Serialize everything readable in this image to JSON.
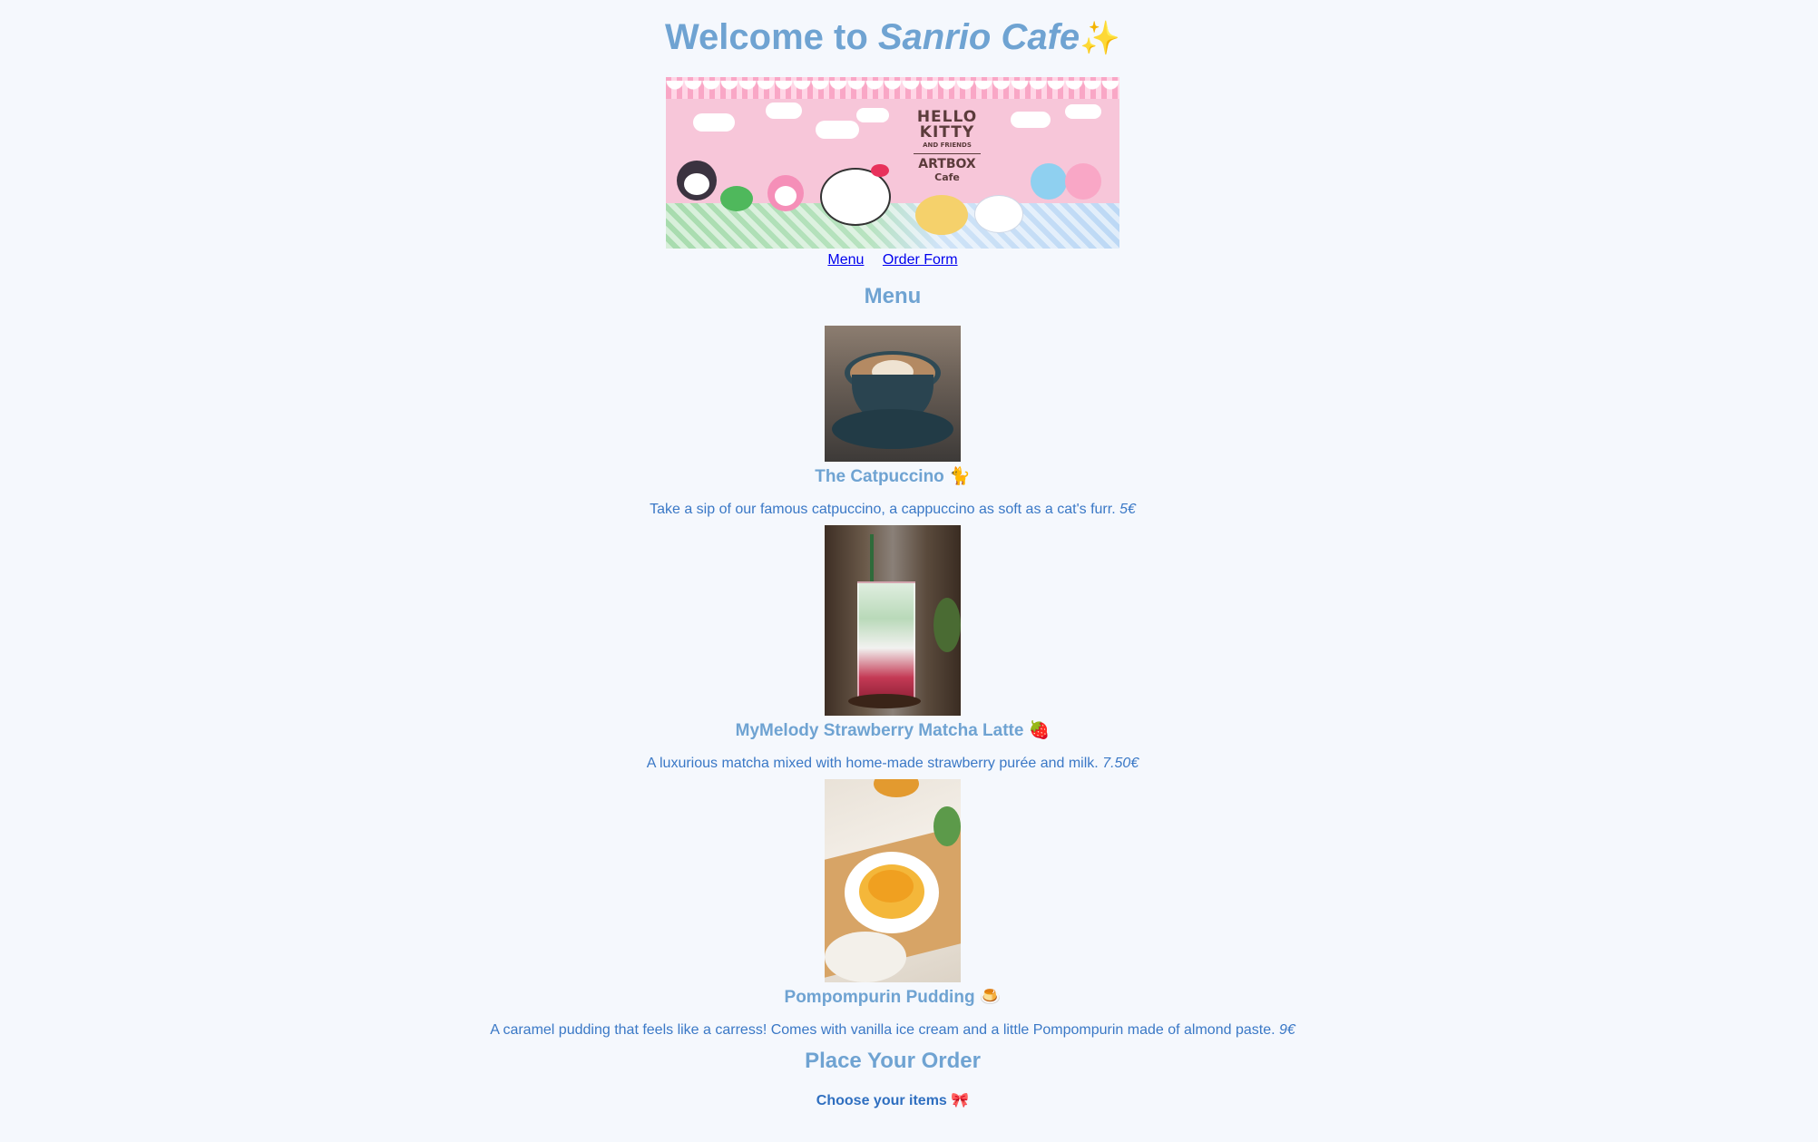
{
  "header": {
    "welcome_prefix": "Welcome to ",
    "cafe_name": "Sanrio Cafe",
    "sparkle": "✨"
  },
  "banner": {
    "line1": "HELLO",
    "line2": "KITTY",
    "line3": "AND FRIENDS",
    "line4": "ARTBOX",
    "line5": "Cafe"
  },
  "nav": {
    "menu": "Menu",
    "order_form": "Order Form"
  },
  "menu": {
    "title": "Menu",
    "items": [
      {
        "name": "The Catpuccino 🐈",
        "description": "Take a sip of our famous catpuccino, a cappuccino as soft as a cat's furr. ",
        "price": "5€"
      },
      {
        "name": "MyMelody Strawberry Matcha Latte 🍓",
        "description": "A luxurious matcha mixed with home-made strawberry purée and milk. ",
        "price": "7.50€"
      },
      {
        "name": "Pompompurin Pudding 🍮",
        "description": "A caramel pudding that feels like a carress! Comes with vanilla ice cream and a little Pompompurin made of almond paste. ",
        "price": "9€"
      }
    ]
  },
  "order": {
    "title": "Place Your Order",
    "choose_label": "Choose your items 🎀"
  },
  "colors": {
    "background": "#f5f8fd",
    "heading": "#6fa3d2",
    "text": "#3a78c6",
    "link": "#0000ee"
  }
}
